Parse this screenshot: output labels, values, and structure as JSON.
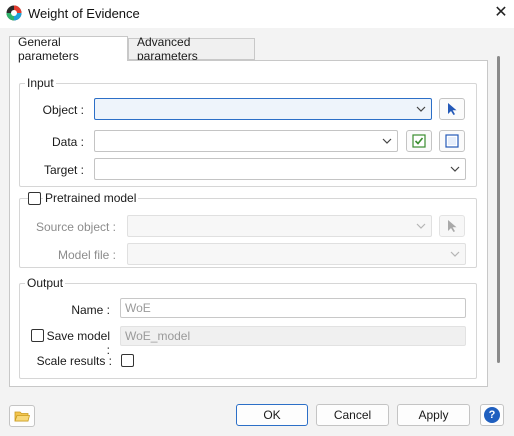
{
  "window": {
    "title": "Weight of Evidence",
    "close": "✕"
  },
  "tabs": [
    {
      "label": "General parameters",
      "active": true
    },
    {
      "label": "Advanced parameters",
      "active": false
    }
  ],
  "input_group": {
    "legend": "Input",
    "object": {
      "label": "Object :",
      "value": ""
    },
    "data": {
      "label": "Data :",
      "value": ""
    },
    "target": {
      "label": "Target :",
      "value": ""
    }
  },
  "pretrained_group": {
    "checkbox_label": "Pretrained model",
    "checked": false,
    "source_object": {
      "label": "Source object :",
      "value": ""
    },
    "model_file": {
      "label": "Model file :",
      "value": ""
    }
  },
  "output_group": {
    "legend": "Output",
    "name": {
      "label": "Name :",
      "value": "WoE"
    },
    "save_model": {
      "label": "Save model :",
      "checked": false,
      "value": "WoE_model"
    },
    "scale_results": {
      "label": "Scale results :",
      "checked": false
    }
  },
  "buttons": {
    "ok": "OK",
    "cancel": "Cancel",
    "apply": "Apply",
    "help": "?"
  },
  "colors": {
    "accent": "#2c6fc7",
    "check_green": "#3a8d2f",
    "help_blue": "#1f5fbf"
  },
  "icons": [
    "app-logo-icon",
    "close-icon",
    "chevron-down-icon",
    "pointer-select-icon",
    "check-all-icon",
    "uncheck-all-icon",
    "folder-open-icon",
    "help-icon"
  ]
}
